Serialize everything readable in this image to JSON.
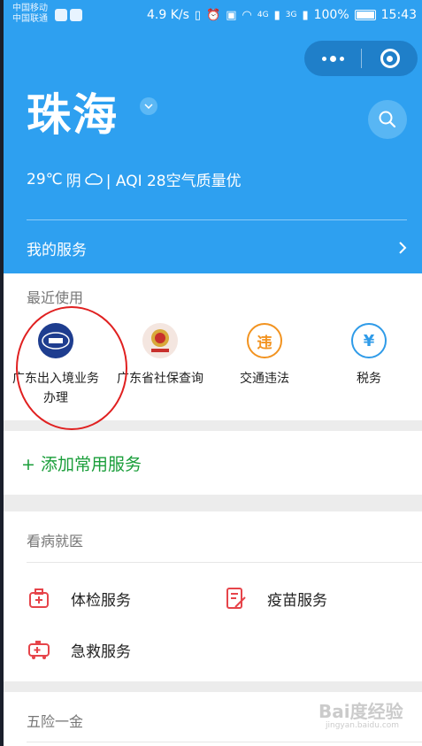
{
  "status_bar": {
    "carrier_1": "中国移动",
    "carrier_2": "中国联通",
    "speed": "4.9 K/s",
    "network_1": "4G",
    "network_2": "3G",
    "battery": "100%",
    "time": "15:43"
  },
  "header": {
    "city": "珠海",
    "weather": {
      "temperature": "29℃",
      "condition": "阴",
      "aqi": "| AQI 28空气质量优"
    },
    "my_services_label": "我的服务"
  },
  "recent": {
    "title": "最近使用",
    "items": [
      {
        "label": "广东出入境业务办理",
        "icon": "immigration-logo"
      },
      {
        "label": "广东省社保查询",
        "icon": "social-security-emblem"
      },
      {
        "label": "交通违法",
        "icon": "traffic-violation-icon",
        "glyph": "违"
      },
      {
        "label": "税务",
        "icon": "tax-icon",
        "glyph": "¥"
      }
    ]
  },
  "add_service": {
    "label": "+ 添加常用服务"
  },
  "health": {
    "title": "看病就医",
    "items": [
      {
        "label": "体检服务",
        "icon": "checkup-icon"
      },
      {
        "label": "疫苗服务",
        "icon": "vaccine-icon"
      },
      {
        "label": "急救服务",
        "icon": "ambulance-icon"
      }
    ]
  },
  "insurance": {
    "title": "五险一金"
  },
  "watermark": {
    "text": "Bai度经验",
    "sub": "jingyan.baidu.com"
  },
  "colors": {
    "header_blue": "#2ea0f0",
    "accent_orange": "#f29320",
    "accent_blue": "#2f9be8",
    "accent_green": "#1a9e3a",
    "accent_red": "#e6444a",
    "annotation_red": "#e02020"
  }
}
